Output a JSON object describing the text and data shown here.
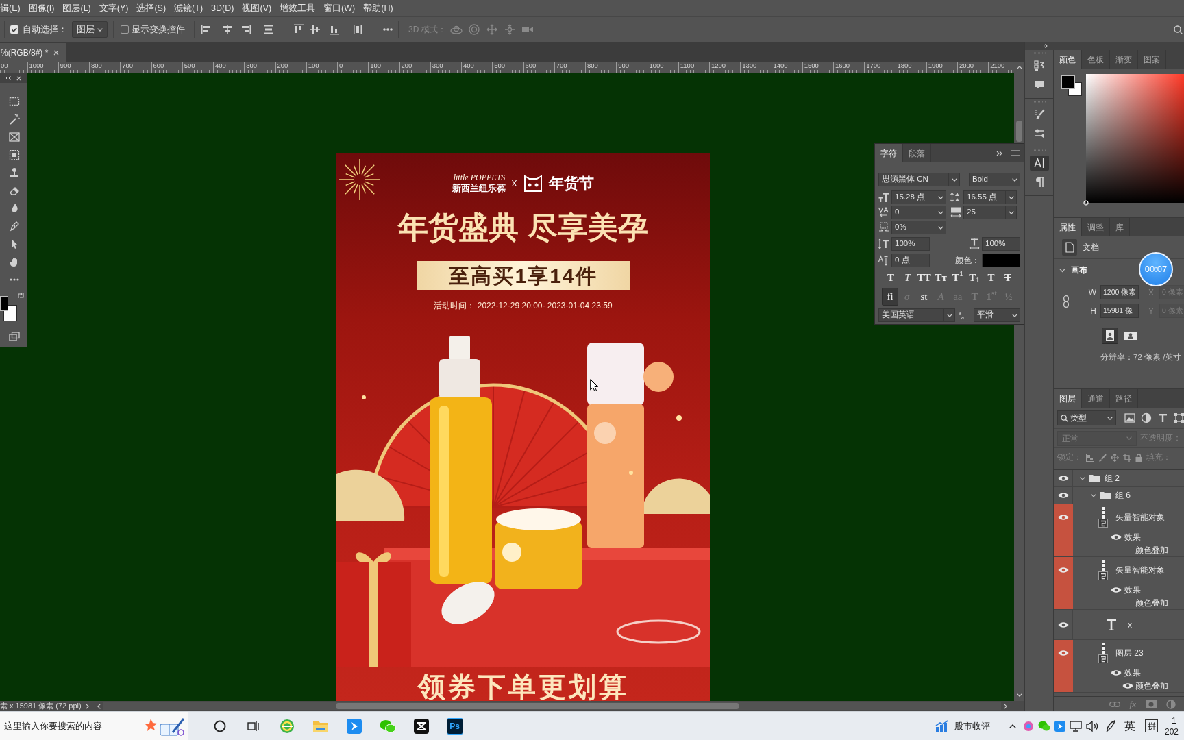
{
  "menu_bar": [
    "辑(E)",
    "图像(I)",
    "图层(L)",
    "文字(Y)",
    "选择(S)",
    "滤镜(T)",
    "3D(D)",
    "视图(V)",
    "增效工具",
    "窗口(W)",
    "帮助(H)"
  ],
  "options_bar": {
    "auto_select": {
      "label": "自动选择：",
      "checked": true
    },
    "auto_select_target": "图层",
    "show_transform": {
      "label": "显示变换控件",
      "checked": false
    },
    "mode_3d": {
      "label": "3D 模式：",
      "disabled": true
    }
  },
  "document_tab": {
    "title": "%(RGB/8#) *"
  },
  "ruler": {
    "labels": [
      "00",
      "1000",
      "900",
      "800",
      "700",
      "600",
      "500",
      "400",
      "300",
      "200",
      "100",
      "0",
      "100",
      "200",
      "300",
      "400",
      "500",
      "600",
      "700",
      "800",
      "900",
      "1000",
      "1100",
      "1200",
      "1300",
      "1400",
      "1500",
      "1600",
      "1700",
      "1800",
      "1900",
      "2000",
      "2100"
    ]
  },
  "poster": {
    "brand": "little POPPETS",
    "brand_cn": "新西兰纽乐葆",
    "cross": "X",
    "event": "年货节",
    "headline": "年货盛典 尽享美孕",
    "offer": "至高买1享14件",
    "period": "活动时间： 2022-12-29 20:00- 2023-01-04 23:59",
    "footer": "领券下单更划算"
  },
  "status_bar": {
    "doc_info": "素 x 15981 像素 (72 ppi)"
  },
  "character_panel": {
    "tabs": [
      {
        "label": "字符",
        "selected": true
      },
      {
        "label": "段落",
        "selected": false
      }
    ],
    "font_family": "思源黑体 CN",
    "font_style": "Bold",
    "size": "15.28 点",
    "leading": "16.55 点",
    "kerning": "0",
    "tracking": "25",
    "tsume": "0%",
    "vertical_scale": "100%",
    "horizontal_scale": "100%",
    "baseline_shift": "0 点",
    "color_label": "颜色：",
    "style_buttons": [
      {
        "kind": "bold",
        "label": "T"
      },
      {
        "kind": "italic",
        "label": "T"
      },
      {
        "kind": "all_caps",
        "label": "TT"
      },
      {
        "kind": "small_caps",
        "label": "Tт"
      },
      {
        "kind": "superscript",
        "label": "T$^{1}$"
      },
      {
        "kind": "subscript",
        "label": "T$_{1}$"
      },
      {
        "kind": "underline",
        "label": "T"
      },
      {
        "kind": "strikethrough",
        "label": "T"
      }
    ],
    "opentype_buttons": [
      {
        "kind": "ligature",
        "label": "fi",
        "selected": true,
        "disabled": false
      },
      {
        "kind": "ornament",
        "label": "σ",
        "selected": false,
        "disabled": true
      },
      {
        "kind": "discretionary",
        "label": "st",
        "selected": false,
        "disabled": false
      },
      {
        "kind": "swash",
        "label": "A",
        "selected": false,
        "disabled": true
      },
      {
        "kind": "alternate",
        "label": "aa",
        "selected": false,
        "disabled": true
      },
      {
        "kind": "titling",
        "label": "T",
        "selected": false,
        "disabled": true
      },
      {
        "kind": "ordinal",
        "label": "1$^{st}$",
        "selected": false,
        "disabled": true
      },
      {
        "kind": "fraction",
        "label": "½",
        "selected": false,
        "disabled": true
      }
    ],
    "language": "美国英语",
    "antialias_icon": "$^{a}$$_{a}$",
    "antialias": "平滑"
  },
  "panel_strip": [
    {
      "buttons": [
        {
          "kind": "history",
          "selected": false
        },
        {
          "kind": "comments",
          "selected": false
        }
      ]
    },
    {
      "buttons": [
        {
          "kind": "brushes",
          "selected": false
        },
        {
          "kind": "brush_settings",
          "selected": false
        }
      ]
    },
    {
      "buttons": [
        {
          "kind": "character",
          "selected": true
        },
        {
          "kind": "paragraph",
          "selected": false
        }
      ]
    }
  ],
  "color_panel": {
    "tabs": [
      {
        "label": "颜色",
        "selected": true
      },
      {
        "label": "色板",
        "selected": false
      },
      {
        "label": "渐变",
        "selected": false
      },
      {
        "label": "图案",
        "selected": false
      }
    ]
  },
  "properties_panel": {
    "tabs": [
      {
        "label": "属性",
        "selected": true
      },
      {
        "label": "调整",
        "selected": false
      },
      {
        "label": "库",
        "selected": false
      }
    ],
    "kind_label": "文档",
    "section": {
      "title": "画布",
      "expanded": true
    },
    "fields": [
      {
        "label": "W",
        "value": "1200 像素",
        "disabled": false
      },
      {
        "label": "X",
        "value": "0 像素",
        "disabled": true
      },
      {
        "label": "H",
        "value": "15981 像",
        "disabled": false
      },
      {
        "label": "Y",
        "value": "0 像素",
        "disabled": true
      }
    ],
    "orientation": [
      {
        "kind": "portrait",
        "selected": true
      },
      {
        "kind": "landscape",
        "selected": false
      }
    ],
    "resolution": "分辨率：72 像素 /英寸"
  },
  "layers_panel": {
    "tabs": [
      {
        "label": "图层",
        "selected": true
      },
      {
        "label": "通道",
        "selected": false
      },
      {
        "label": "路径",
        "selected": false
      }
    ],
    "filter": "类型",
    "blend_mode": "正常",
    "opacity_label": "不透明度：",
    "lock_label": "锁定：",
    "fill_label": "填充：",
    "options_disabled": true,
    "layers": [
      {
        "kind": "group",
        "name": "组 2",
        "visible": true,
        "expanded": true,
        "children": [
          {
            "kind": "group",
            "name": "组 6",
            "visible": true,
            "expanded": true,
            "children": [
              {
                "kind": "smart",
                "name": "矢量智能对象",
                "visible": true,
                "color": "#c6523f",
                "effects": {
                  "label": "效果",
                  "visible": true,
                  "items": [
                    {
                      "name": "颜色叠加",
                      "visible": false
                    }
                  ]
                }
              },
              {
                "kind": "smart",
                "name": "矢量智能对象",
                "visible": true,
                "color": "#c6523f",
                "effects": {
                  "label": "效果",
                  "visible": true,
                  "items": [
                    {
                      "name": "颜色叠加",
                      "visible": false
                    }
                  ]
                }
              },
              {
                "kind": "text",
                "name": "x",
                "visible": true
              },
              {
                "kind": "smart",
                "name": "图层 23",
                "visible": true,
                "color": "#c6523f",
                "effects": {
                  "label": "效果",
                  "visible": true,
                  "items": [
                    {
                      "name": "颜色叠加",
                      "visible": true
                    }
                  ]
                }
              }
            ]
          }
        ]
      }
    ],
    "footer_fx": "fx"
  },
  "timer": "00:07",
  "taskbar": {
    "search_placeholder": "这里输入你要搜索的内容",
    "ps_label": "Ps",
    "news": "股市收评",
    "input_language": "英",
    "input_mode": "拼",
    "clock": [
      "1",
      "202"
    ]
  }
}
